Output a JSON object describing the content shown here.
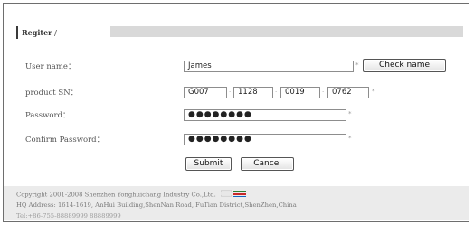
{
  "header": {
    "title": "Regiter",
    "slash": "/"
  },
  "form": {
    "username_label": "User name：",
    "username_value": "James",
    "sn_label": "product SN：",
    "sn_values": [
      "G007",
      "1128",
      "0019",
      "0762"
    ],
    "sn_dot": ".",
    "password_label": "Password：",
    "password_value": "●●●●●●●●",
    "confirm_label": "Confirm Password：",
    "confirm_value": "●●●●●●●●",
    "required_mark": "*",
    "check_name_label": "Check name",
    "submit_label": "Submit",
    "cancel_label": "Cancel"
  },
  "footer": {
    "copyright": "Copyright 2001-2008 Shenzhen Yonghuichang Industry Co.,Ltd.",
    "address": "HQ Address: 1614-1619, AnHui Building,ShenNan Road, FuTian District,ShenZhen,China",
    "tel": "Tel:+86-755-88889999 88889999"
  },
  "colors": {
    "frame": "#6e6e6e",
    "title_bar": "#d9d9d9",
    "footer_bg": "#ebebeb"
  }
}
